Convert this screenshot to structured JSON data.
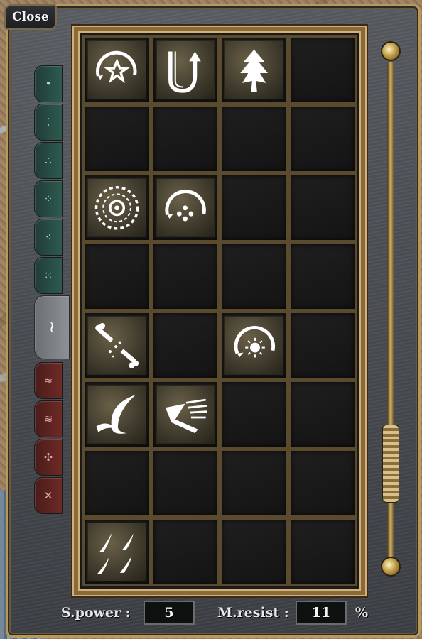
{
  "window": {
    "close_label": "Close"
  },
  "tabs": [
    {
      "icon": "dot-icon",
      "glyph": "•",
      "color": "green"
    },
    {
      "icon": "dots-icon",
      "glyph": "⁚",
      "color": "green"
    },
    {
      "icon": "dots-icon",
      "glyph": "∴",
      "color": "green"
    },
    {
      "icon": "dots-icon",
      "glyph": "⁘",
      "color": "green"
    },
    {
      "icon": "dots-icon",
      "glyph": "⁖",
      "color": "green"
    },
    {
      "icon": "dots-icon",
      "glyph": "⁙",
      "color": "green"
    },
    {
      "icon": "wave-icon",
      "glyph": "≀",
      "color": "grey",
      "active": true
    },
    {
      "icon": "rune-icon",
      "glyph": "≈",
      "color": "red"
    },
    {
      "icon": "rune-icon",
      "glyph": "≋",
      "color": "red"
    },
    {
      "icon": "rune-icon",
      "glyph": "✣",
      "color": "red"
    },
    {
      "icon": "rune-icon",
      "glyph": "✕",
      "color": "red"
    }
  ],
  "grid": {
    "rows": 8,
    "cols": 4,
    "skills": [
      {
        "row": 0,
        "col": 0,
        "icon": "arc-star-icon"
      },
      {
        "row": 0,
        "col": 1,
        "icon": "up-arrow-swirl-icon"
      },
      {
        "row": 0,
        "col": 2,
        "icon": "leaf-tree-icon"
      },
      {
        "row": 2,
        "col": 0,
        "icon": "eye-sun-icon"
      },
      {
        "row": 2,
        "col": 1,
        "icon": "arc-dots-icon"
      },
      {
        "row": 4,
        "col": 0,
        "icon": "bone-sparkle-icon"
      },
      {
        "row": 4,
        "col": 2,
        "icon": "arc-sun-icon"
      },
      {
        "row": 5,
        "col": 0,
        "icon": "crescent-claw-icon"
      },
      {
        "row": 5,
        "col": 1,
        "icon": "wing-icon"
      },
      {
        "row": 7,
        "col": 0,
        "icon": "four-claws-icon"
      }
    ]
  },
  "stats": {
    "spower_label": "S.power :",
    "spower_value": "5",
    "mresist_label": "M.resist :",
    "mresist_value": "11",
    "percent": "%"
  },
  "colors": {
    "frame_gold": "#b8985c",
    "panel_bg": "#4a4e53",
    "tab_green": "#2f5a50",
    "tab_red": "#6e2a26"
  }
}
